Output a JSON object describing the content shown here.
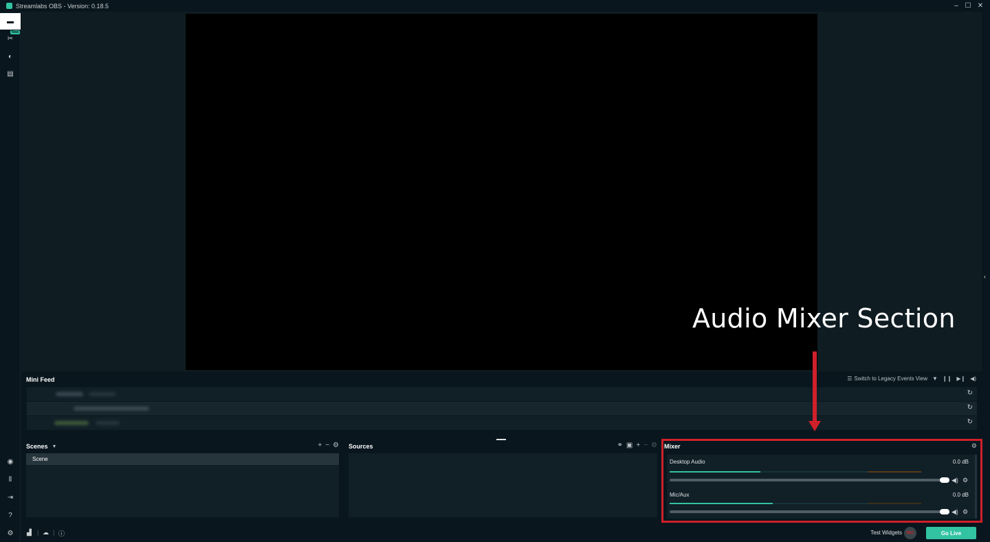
{
  "window": {
    "title": "Streamlabs OBS - Version: 0.18.5",
    "minimize_icon": "minimize-icon",
    "maximize_icon": "maximize-icon",
    "close_icon": "close-icon"
  },
  "sidebar": {
    "top_items": [
      {
        "name": "editor",
        "icon": "scene-editor-icon",
        "active": true
      },
      {
        "name": "themes",
        "icon": "themes-icon",
        "badge": "New"
      },
      {
        "name": "dashboard",
        "icon": "dashboard-icon"
      },
      {
        "name": "store",
        "icon": "store-icon"
      }
    ],
    "new_badge": "New",
    "bottom_items": [
      "studio-mode-icon",
      "layout-icon",
      "logout-icon",
      "help-icon",
      "settings-icon"
    ]
  },
  "mini_feed": {
    "title": "Mini Feed",
    "legacy_link": "Switch to Legacy Events View"
  },
  "scenes": {
    "title": "Scenes",
    "items": [
      "Scene"
    ]
  },
  "sources": {
    "title": "Sources"
  },
  "mixer": {
    "title": "Mixer",
    "channels": [
      {
        "name": "Desktop Audio",
        "db": "0.0 dB",
        "level": 0.36,
        "volume": 1.0
      },
      {
        "name": "Mic/Aux",
        "db": "0.0 dB",
        "level": 0.41,
        "volume": 1.0
      }
    ]
  },
  "annotation": {
    "text": "Audio Mixer Section",
    "color": "#d0202a"
  },
  "footer": {
    "test_widgets": "Test Widgets",
    "rec_label": "REC",
    "go_live": "Go Live"
  },
  "colors": {
    "accent": "#31c3a2",
    "background": "#09161d",
    "panel": "#111f27",
    "highlight": "#d0202a"
  }
}
